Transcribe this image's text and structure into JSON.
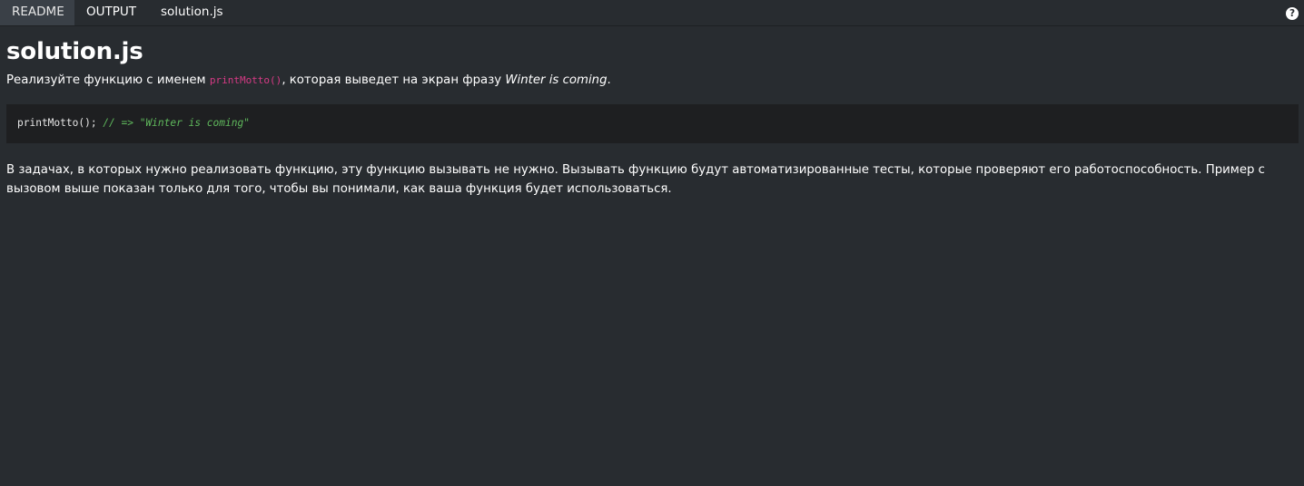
{
  "tabs": {
    "readme": "README",
    "output": "OUTPUT",
    "solution": "solution.js"
  },
  "help_icon": "?",
  "title": "solution.js",
  "intro": {
    "before": "Реализуйте функцию с именем ",
    "code": "printMotto()",
    "middle": ", которая выведет на экран фразу ",
    "emphasis": "Winter is coming",
    "after": "."
  },
  "code_example": {
    "code": "printMotto(); ",
    "comment": "// => \"Winter is coming\""
  },
  "paragraph": "В задачах, в которых нужно реализовать функцию, эту функцию вызывать не нужно. Вызывать функцию будут автоматизированные тесты, которые проверяют его работоспособность. Пример с вызовом выше показан только для того, чтобы вы понимали, как ваша функция будет использоваться.",
  "colors": {
    "background": "#282c30",
    "active_tab": "#3a4047",
    "code_background": "#1e1f21",
    "inline_code": "#d63a85",
    "comment": "#5fb85c"
  }
}
